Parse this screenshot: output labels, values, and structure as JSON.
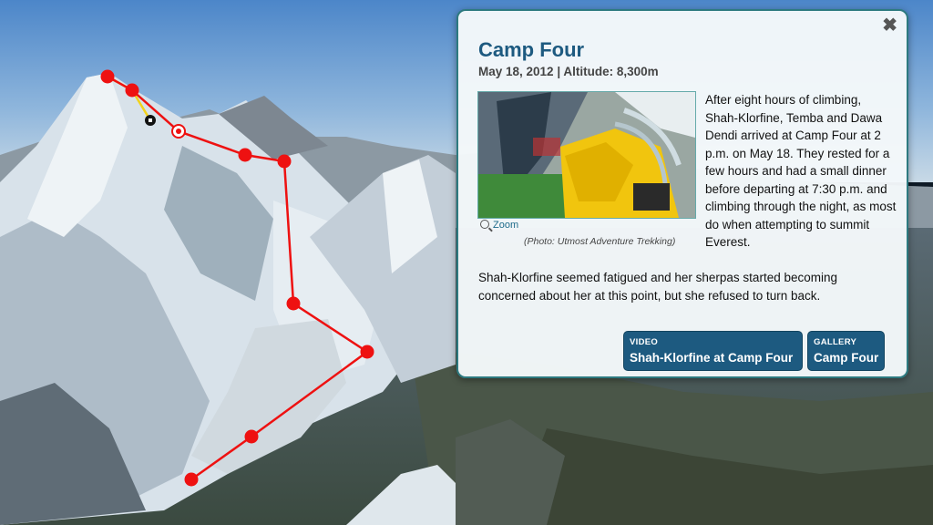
{
  "map": {
    "route_color": "#ee1111",
    "route_points": [
      "point-1",
      "point-2",
      "point-3",
      "point-4",
      "point-5",
      "point-6",
      "point-7",
      "point-8",
      "point-9"
    ],
    "summit_markers": [
      "current-position-marker",
      "camp-target-marker"
    ]
  },
  "info_panel": {
    "close_label": "✖",
    "title": "Camp Four",
    "subtitle": "May 18, 2012 | Altitude: 8,300m",
    "zoom_label": "Zoom",
    "photo_credit": "(Photo: Utmost Adventure Trekking)",
    "paragraph_1": "After eight hours of climbing, Shah-Klorfine, Temba and Dawa Dendi arrived at Camp Four at 2 p.m. on May 18. They rested for a few hours and had a small dinner before departing at 7:30 p.m. and climbing through the night, as most do when attempting to summit Everest.",
    "paragraph_2": "Shah-Klorfine seemed fatigued and her sherpas started becoming concerned about her at this point, but she refused to turn back.",
    "video_button": {
      "kind": "VIDEO",
      "label": "Shah-Klorfine at Camp Four"
    },
    "gallery_button": {
      "kind": "GALLERY",
      "label": "Camp Four"
    },
    "accent_color": "#1d5a80"
  }
}
